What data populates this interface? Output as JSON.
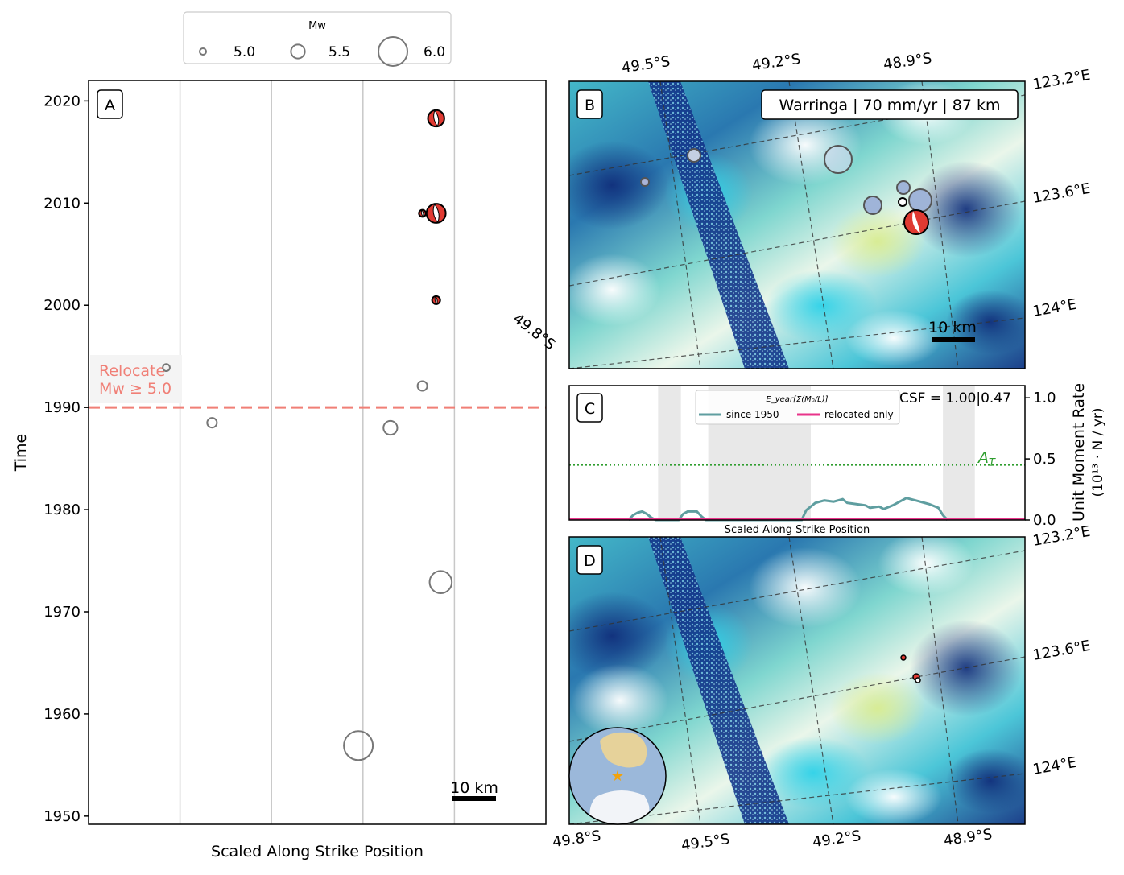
{
  "legend": {
    "title": "Mw",
    "entries": [
      {
        "label": "5.0",
        "mw": 5.0
      },
      {
        "label": "5.5",
        "mw": 5.5
      },
      {
        "label": "6.0",
        "mw": 6.0
      }
    ]
  },
  "colors": {
    "beachball_red": "#e03a32",
    "open_circle": "#777777",
    "relocate_line": "#f07f76",
    "grid": "#c8c8c8",
    "since1950": "#5f9ea0",
    "relocated_only": "#e8338a",
    "threshold": "#2e9d2e",
    "grey_band": "#e8e8e8"
  },
  "chart_data": [
    {
      "id": "A",
      "type": "scatter",
      "panel_label": "A",
      "xlabel": "Scaled Along Strike Position",
      "ylabel": "Time",
      "ylim": [
        1949.2,
        2022
      ],
      "xlim": [
        0,
        100
      ],
      "yticks": [
        1950,
        1960,
        1970,
        1980,
        1990,
        2000,
        2010,
        2020
      ],
      "grid_x": [
        20,
        40,
        60,
        80
      ],
      "scale_bar": "10 km",
      "relocate": {
        "line1": "Relocate",
        "line2": "Mw ≥ 5.0",
        "year": 1990
      },
      "events": [
        {
          "x": 76,
          "year": 2018.3,
          "mw": 5.6,
          "style": "beachball"
        },
        {
          "x": 76,
          "year": 2009.0,
          "mw": 5.7,
          "style": "beachball"
        },
        {
          "x": 73,
          "year": 2009.0,
          "mw": 5.1,
          "style": "beachball"
        },
        {
          "x": 76,
          "year": 2000.5,
          "mw": 5.2,
          "style": "beachball"
        },
        {
          "x": 17,
          "year": 1993.9,
          "mw": 5.1,
          "style": "open"
        },
        {
          "x": 73,
          "year": 1992.1,
          "mw": 5.3,
          "style": "open"
        },
        {
          "x": 27,
          "year": 1988.5,
          "mw": 5.3,
          "style": "open"
        },
        {
          "x": 66,
          "year": 1988.0,
          "mw": 5.5,
          "style": "open"
        },
        {
          "x": 77,
          "year": 1972.9,
          "mw": 5.8,
          "style": "open"
        },
        {
          "x": 59,
          "year": 1956.9,
          "mw": 6.0,
          "style": "open"
        }
      ]
    },
    {
      "id": "C",
      "type": "line",
      "panel_label": "C",
      "xlabel": "Scaled Along Strike Position",
      "ylabel_line1": "Unit Moment Rate",
      "ylabel_line2": "(10¹³ · N / yr)",
      "ylim": [
        0,
        1.1
      ],
      "xlim": [
        0,
        100
      ],
      "yticks": [
        "0.0",
        "0.5",
        "1.0"
      ],
      "csf": "CSF = 1.00|0.47",
      "threshold": {
        "label": "A_T",
        "value": 0.45
      },
      "legend_title": "E_year[Σ(M₀/L)]",
      "series": [
        {
          "name": "since 1950",
          "x": [
            13,
            14,
            15,
            16,
            17,
            18,
            19,
            24,
            25,
            26,
            28,
            29,
            30,
            31,
            33,
            36,
            38,
            40,
            41,
            43,
            45,
            48,
            51,
            52,
            54,
            56,
            58,
            60,
            61,
            63,
            65,
            66,
            68,
            69,
            71,
            73,
            74,
            75,
            77,
            79,
            81,
            82,
            83
          ],
          "y": [
            0,
            0.04,
            0.06,
            0.07,
            0.05,
            0.02,
            0,
            0,
            0.05,
            0.07,
            0.07,
            0.03,
            0,
            0,
            0,
            0,
            0,
            0,
            0,
            0,
            0,
            0,
            0,
            0.08,
            0.14,
            0.16,
            0.15,
            0.17,
            0.14,
            0.13,
            0.12,
            0.1,
            0.11,
            0.09,
            0.12,
            0.16,
            0.18,
            0.17,
            0.15,
            0.13,
            0.1,
            0.04,
            0
          ]
        },
        {
          "name": "relocated only",
          "x": [
            0,
            100
          ],
          "y": [
            0,
            0
          ]
        }
      ],
      "grey_bands": [
        [
          19.5,
          24.5
        ],
        [
          30.5,
          53
        ],
        [
          82,
          89
        ]
      ]
    }
  ],
  "map_b": {
    "panel_label": "B",
    "info": "Warringa | 70 mm/yr | 87 km",
    "top_labels": [
      "49.5°S",
      "49.2°S",
      "48.9°S"
    ],
    "right_labels": [
      "123.2°E",
      "123.6°E",
      "124°E"
    ],
    "left_label": "49.8°S",
    "scale_bar": "10 km"
  },
  "map_d": {
    "panel_label": "D",
    "bottom_labels": [
      "49.8°S",
      "49.5°S",
      "49.2°S",
      "48.9°S"
    ],
    "right_labels": [
      "123.2°E",
      "123.6°E",
      "124°E"
    ]
  }
}
